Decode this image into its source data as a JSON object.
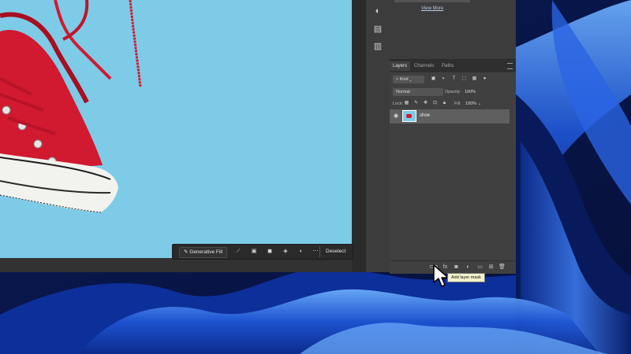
{
  "layers_panel": {
    "tabs": [
      "Layers",
      "Channels",
      "Paths"
    ],
    "active_tab": "Layers",
    "filter_kind": "Kind",
    "blend_mode": "Normal",
    "opacity_label": "Opacity:",
    "opacity_value": "100%",
    "lock_label": "Lock:",
    "fill_label": "Fill:",
    "fill_value": "100%",
    "layers": [
      {
        "name": "shoe",
        "visible": true,
        "selected": true
      }
    ],
    "footer_icons": [
      "link-icon",
      "fx-icon",
      "add-layer-mask-icon",
      "adjustment-layer-icon",
      "folder-icon",
      "new-layer-icon",
      "trash-icon"
    ]
  },
  "upper_panel": {
    "view_more_label": "View More"
  },
  "context_bar": {
    "generative_fill_label": "Generative Fill",
    "deselect_label": "Deselect",
    "icons": [
      "brush-icon",
      "transform-icon",
      "mask-icon",
      "fill-bucket-icon",
      "invert-icon",
      "more-icon"
    ]
  },
  "tooltip": {
    "text": "Add layer mask"
  },
  "colors": {
    "canvas_bg": "#7ecbe7",
    "shoe_red": "#d11a2f",
    "panel_bg": "#404040",
    "wallpaper_blue": "#1c3fa8"
  }
}
